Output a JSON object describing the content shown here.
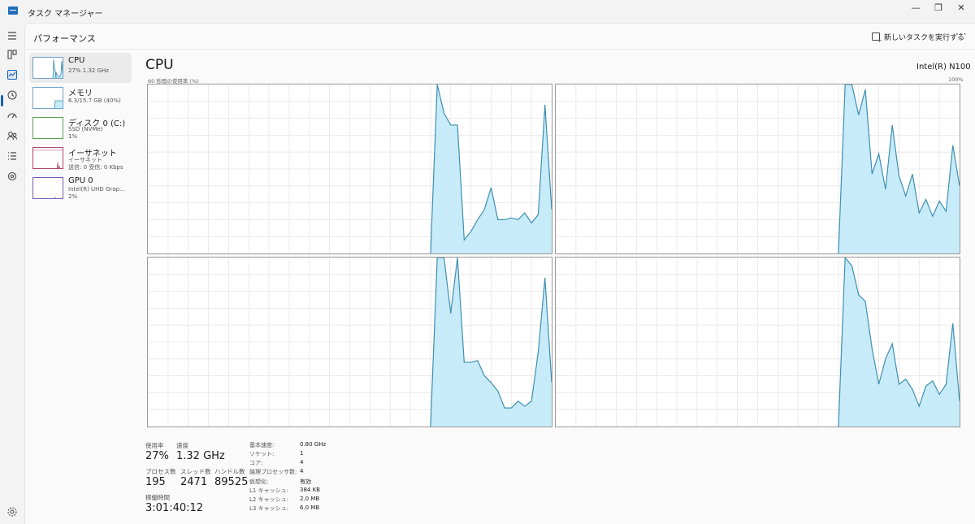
{
  "window": {
    "title": "タスク マネージャー",
    "min_glyph": "—",
    "max_glyph": "❐",
    "close_glyph": "✕"
  },
  "rail": {
    "icons": [
      "hamburger-icon",
      "processes-icon",
      "performance-icon",
      "history-icon",
      "startup-icon",
      "users-icon",
      "details-icon",
      "services-icon",
      "settings-icon"
    ]
  },
  "header": {
    "title": "パフォーマンス",
    "run_task_label": "新しいタスクを実行する",
    "more_glyph": "···"
  },
  "resources": [
    {
      "name": "CPU",
      "sub1": "27%  1.32 GHz",
      "sub2": ""
    },
    {
      "name": "メモリ",
      "sub1": "6.3/15.7 GB (40%)",
      "sub2": ""
    },
    {
      "name": "ディスク 0 (C:)",
      "sub1": "SSD (NVMe)",
      "sub2": "1%"
    },
    {
      "name": "イーサネット",
      "sub1": "イーサネット",
      "sub2": "送信: 0 受信: 0 Kbps"
    },
    {
      "name": "GPU 0",
      "sub1": "Intel(R) UHD Grap...",
      "sub2": "2%"
    }
  ],
  "main": {
    "title": "CPU",
    "model": "Intel(R) N100",
    "util_label": "60 秒間の使用率 (%)",
    "max_pct": "100%"
  },
  "colors": {
    "accent": "#1a62b3",
    "graph_fill": "#c7ebf9",
    "graph_line": "#3f8fb0",
    "grid": "#e6e6e6"
  },
  "chart_data": {
    "type": "area",
    "xlabel": "",
    "ylabel": "60 秒間の使用率 (%)",
    "x_seconds": [
      42,
      43,
      44,
      45,
      46,
      47,
      48,
      49,
      50,
      51,
      52,
      53,
      54,
      55,
      56,
      57,
      58,
      59,
      60
    ],
    "ylim": [
      0,
      100
    ],
    "grid": true,
    "series": [
      {
        "values": [
          0,
          100,
          83,
          76,
          76,
          8,
          13,
          20,
          26,
          39,
          20,
          20,
          21,
          20,
          24,
          18,
          23,
          88,
          26
        ]
      },
      {
        "values": [
          0,
          100,
          100,
          82,
          97,
          47,
          59,
          38,
          76,
          46,
          34,
          47,
          24,
          32,
          22,
          31,
          25,
          64,
          40
        ]
      },
      {
        "values": [
          0,
          100,
          100,
          67,
          100,
          38,
          38,
          39,
          30,
          26,
          21,
          11,
          11,
          15,
          12,
          15,
          44,
          88,
          26
        ]
      },
      {
        "values": [
          0,
          100,
          95,
          78,
          74,
          46,
          25,
          40,
          49,
          25,
          28,
          22,
          12,
          24,
          27,
          19,
          25,
          61,
          15
        ]
      }
    ]
  },
  "stats": {
    "usage_label": "使用率",
    "usage_value": "27%",
    "speed_label": "速度",
    "speed_value": "1.32 GHz",
    "processes_label": "プロセス数",
    "processes_value": "195",
    "threads_label": "スレッド数",
    "threads_value": "2471",
    "handles_label": "ハンドル数",
    "handles_value": "89525",
    "uptime_label": "稼働時間",
    "uptime_value": "3:01:40:12"
  },
  "specs": [
    {
      "label": "基本速度:",
      "value": "0.80 GHz"
    },
    {
      "label": "ソケット:",
      "value": "1"
    },
    {
      "label": "コア:",
      "value": "4"
    },
    {
      "label": "論理プロセッサ数:",
      "value": "4"
    },
    {
      "label": "仮想化:",
      "value": "有効"
    },
    {
      "label": "L1 キャッシュ:",
      "value": "384 KB"
    },
    {
      "label": "L2 キャッシュ:",
      "value": "2.0 MB"
    },
    {
      "label": "L3 キャッシュ:",
      "value": "6.0 MB"
    }
  ]
}
